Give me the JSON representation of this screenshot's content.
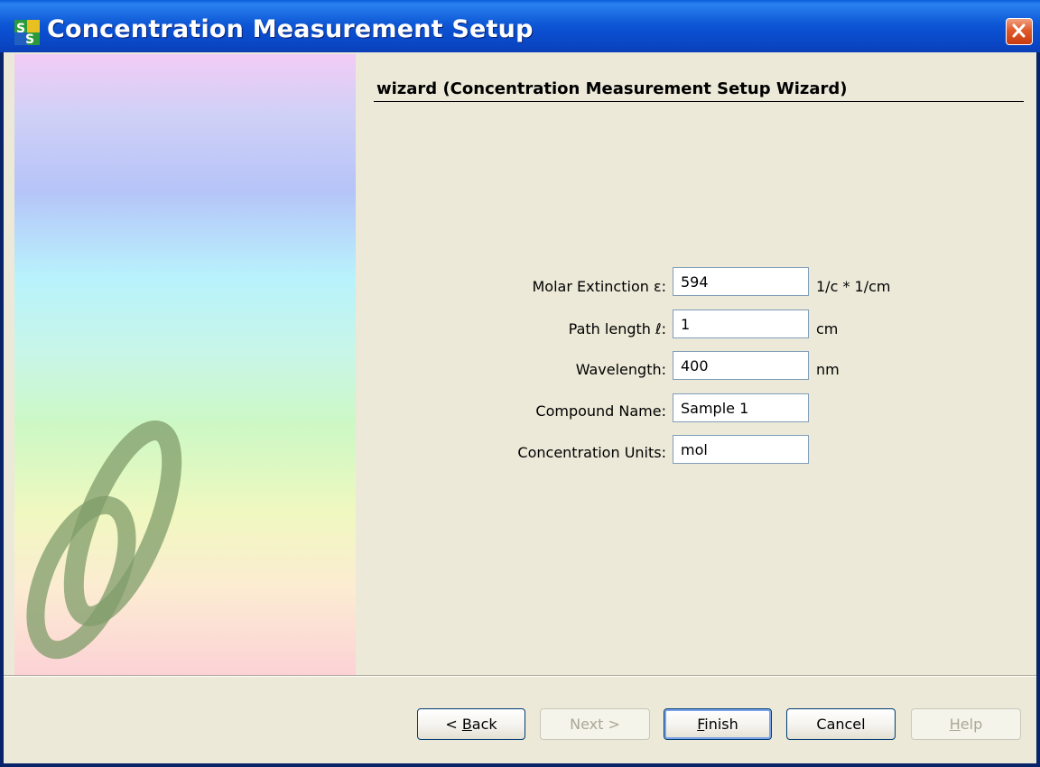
{
  "window": {
    "title": "Concentration Measurement Setup",
    "icon": "spectrasuite-app-icon"
  },
  "wizard": {
    "heading": "wizard (Concentration Measurement Setup Wizard)",
    "fields": [
      {
        "label": "Molar Extinction ε:",
        "value": "594",
        "unit": "1/c * 1/cm"
      },
      {
        "label": "Path length ℓ:",
        "value": "1",
        "unit": "cm"
      },
      {
        "label": "Wavelength:",
        "value": "400",
        "unit": "nm"
      },
      {
        "label": "Compound Name:",
        "value": "Sample 1"
      },
      {
        "label": "Concentration Units:",
        "value": "mol"
      }
    ]
  },
  "buttons": {
    "back": {
      "prefix": "< ",
      "mnemonic": "B",
      "rest": "ack",
      "enabled": true
    },
    "next": {
      "label": "Next >",
      "enabled": false
    },
    "finish": {
      "mnemonic": "F",
      "rest": "inish",
      "enabled": true,
      "default": true
    },
    "cancel": {
      "label": "Cancel",
      "enabled": true
    },
    "help": {
      "mnemonic": "H",
      "rest": "elp",
      "enabled": false
    }
  },
  "colors": {
    "title_bar": "#0a4fd0",
    "dialog_background": "#ece9d8",
    "close_button": "#e05a2a"
  }
}
